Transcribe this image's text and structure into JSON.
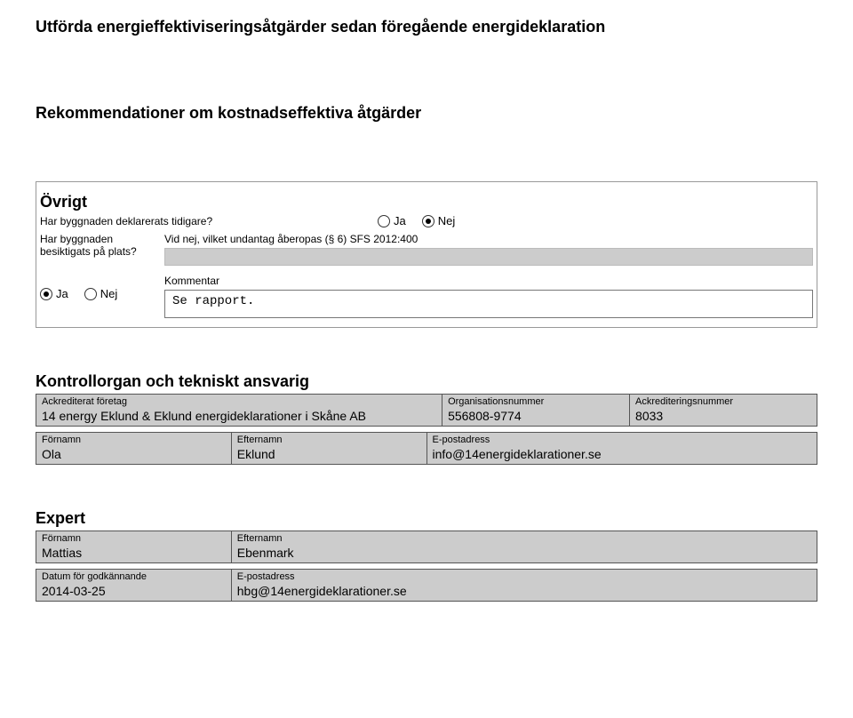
{
  "headings": {
    "utforda": "Utförda energieffektiviseringsåtgärder sedan föregående energideklaration",
    "rekommendationer": "Rekommendationer om kostnadseffektiva åtgärder",
    "ovrigt": "Övrigt",
    "kontrollorgan": "Kontrollorgan och tekniskt ansvarig",
    "expert": "Expert"
  },
  "ovrigt": {
    "q1_label": "Har byggnaden deklarerats tidigare?",
    "q1_ja": "Ja",
    "q1_nej": "Nej",
    "q1_selected": "Nej",
    "q2_label_line1": "Har byggnaden",
    "q2_label_line2": "besiktigats på plats?",
    "q2_exc_label": "Vid nej, vilket undantag åberopas (§ 6) SFS 2012:400",
    "q2_ja": "Ja",
    "q2_nej": "Nej",
    "q2_selected": "Ja",
    "kommentar_label": "Kommentar",
    "kommentar_value": "Se rapport."
  },
  "kontroll": {
    "col1_label": "Ackrediterat företag",
    "col1_value": "14 energy Eklund & Eklund energideklarationer i Skåne AB",
    "col2_label": "Organisationsnummer",
    "col2_value": "556808-9774",
    "col3_label": "Ackrediteringsnummer",
    "col3_value": "8033",
    "r2c1_label": "Förnamn",
    "r2c1_value": "Ola",
    "r2c2_label": "Efternamn",
    "r2c2_value": "Eklund",
    "r2c3_label": "E-postadress",
    "r2c3_value": "info@14energideklarationer.se"
  },
  "expert": {
    "r1c1_label": "Förnamn",
    "r1c1_value": "Mattias",
    "r1c2_label": "Efternamn",
    "r1c2_value": "Ebenmark",
    "r2c1_label": "Datum för godkännande",
    "r2c1_value": "2014-03-25",
    "r2c2_label": "E-postadress",
    "r2c2_value": "hbg@14energideklarationer.se"
  }
}
